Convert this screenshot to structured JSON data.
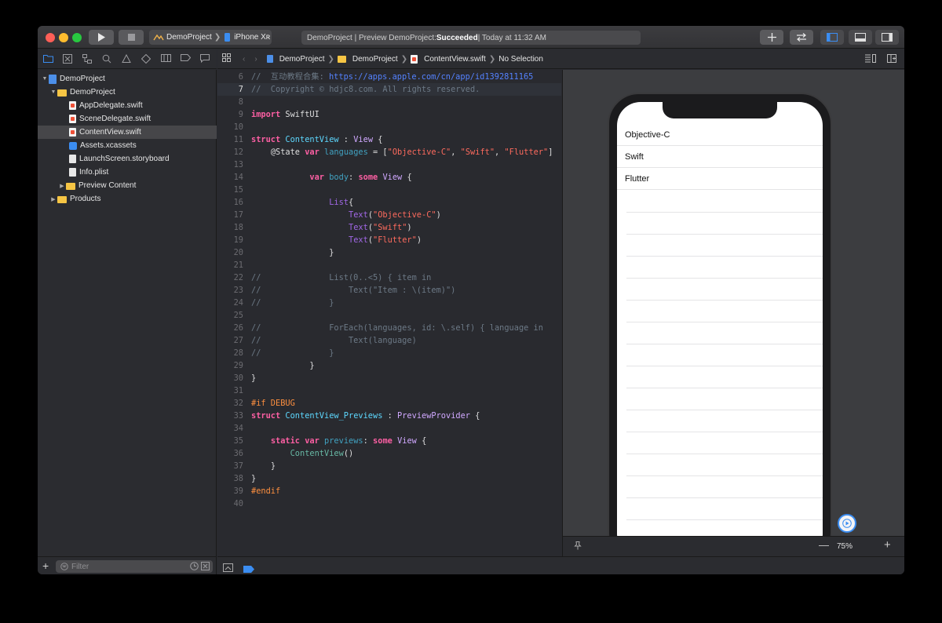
{
  "toolbar": {
    "scheme_project": "DemoProject",
    "scheme_device": "iPhone Xʀ",
    "status_prefix": "DemoProject | Preview DemoProject: ",
    "status_result": "Succeeded",
    "status_time": " | Today at 11:32 AM"
  },
  "navigator": {
    "rows": [
      {
        "label": "DemoProject"
      },
      {
        "label": "DemoProject"
      },
      {
        "label": "AppDelegate.swift"
      },
      {
        "label": "SceneDelegate.swift"
      },
      {
        "label": "ContentView.swift"
      },
      {
        "label": "Assets.xcassets"
      },
      {
        "label": "LaunchScreen.storyboard"
      },
      {
        "label": "Info.plist"
      },
      {
        "label": "Preview Content"
      },
      {
        "label": "Products"
      }
    ],
    "filter_placeholder": "Filter"
  },
  "jumpbar": {
    "crumbs": [
      "DemoProject",
      "DemoProject",
      "ContentView.swift",
      "No Selection"
    ]
  },
  "editor": {
    "current_line": 7,
    "lines": [
      {
        "n": "6"
      },
      {
        "n": "7"
      },
      {
        "n": "8"
      },
      {
        "n": "9"
      },
      {
        "n": "10"
      },
      {
        "n": "11"
      },
      {
        "n": "12"
      },
      {
        "n": "13"
      },
      {
        "n": "14"
      },
      {
        "n": "15"
      },
      {
        "n": "16"
      },
      {
        "n": "17"
      },
      {
        "n": "18"
      },
      {
        "n": "19"
      },
      {
        "n": "20"
      },
      {
        "n": "21"
      },
      {
        "n": "22"
      },
      {
        "n": "23"
      },
      {
        "n": "24"
      },
      {
        "n": "25"
      },
      {
        "n": "26"
      },
      {
        "n": "27"
      },
      {
        "n": "28"
      },
      {
        "n": "29"
      },
      {
        "n": "30"
      },
      {
        "n": "31"
      },
      {
        "n": "32"
      },
      {
        "n": "33"
      },
      {
        "n": "34"
      },
      {
        "n": "35"
      },
      {
        "n": "36"
      },
      {
        "n": "37"
      },
      {
        "n": "38"
      },
      {
        "n": "39"
      },
      {
        "n": "40"
      }
    ],
    "code": {
      "l6_comment": "//  互动教程合集: ",
      "l6_url": "https://apps.apple.com/cn/app/id1392811165",
      "l7": "//  Copyright © hdjc8.com. All rights reserved.",
      "l9_kw": "import",
      "l9_rest": " SwiftUI",
      "l11_kw": "struct",
      "l11_name": "ContentView",
      "l11_colon": " : ",
      "l11_type": "View",
      "l11_brace": " {",
      "l12_attr": "@State",
      "l12_kw": "var",
      "l12_name": "languages",
      "l12_eq": " = [",
      "l12_s1": "\"Objective-C\"",
      "l12_c1": ", ",
      "l12_s2": "\"Swift\"",
      "l12_c2": ", ",
      "l12_s3": "\"Flutter\"",
      "l12_end": "]",
      "l14_kw": "var",
      "l14_name": "body",
      "l14_colon": ": ",
      "l14_some": "some",
      "l14_type": "View",
      "l14_brace": " {",
      "l16_fn": "List",
      "l16_brace": "{",
      "l17_fn": "Text",
      "l17_str": "\"Objective-C\"",
      "l18_fn": "Text",
      "l18_str": "\"Swift\"",
      "l19_fn": "Text",
      "l19_str": "\"Flutter\"",
      "l20": "}",
      "l22": "//              List(0..<5) { item in",
      "l23": "//                  Text(\"Item : \\(item)\")",
      "l24": "//              }",
      "l26": "//              ForEach(languages, id: \\.self) { language in",
      "l27": "//                  Text(language)",
      "l28": "//              }",
      "l29": "}",
      "l30": "}",
      "l32": "#if DEBUG",
      "l33_kw": "struct",
      "l33_name": "ContentView_Previews",
      "l33_colon": " : ",
      "l33_type": "PreviewProvider",
      "l33_brace": " {",
      "l35_kw1": "static",
      "l35_kw2": "var",
      "l35_name": "previews",
      "l35_colon": ": ",
      "l35_some": "some",
      "l35_type": "View",
      "l35_brace": " {",
      "l36_fn": "ContentView",
      "l36_paren": "()",
      "l37": "}",
      "l38": "}",
      "l39": "#endif"
    }
  },
  "preview": {
    "items": [
      "Objective-C",
      "Swift",
      "Flutter"
    ],
    "zoom": "75%"
  },
  "colors": {
    "accent": "#3b8df1",
    "keyword": "#fc5fa3",
    "string": "#fc6a5d",
    "comment": "#6c7986",
    "type": "#5dd8ff"
  }
}
